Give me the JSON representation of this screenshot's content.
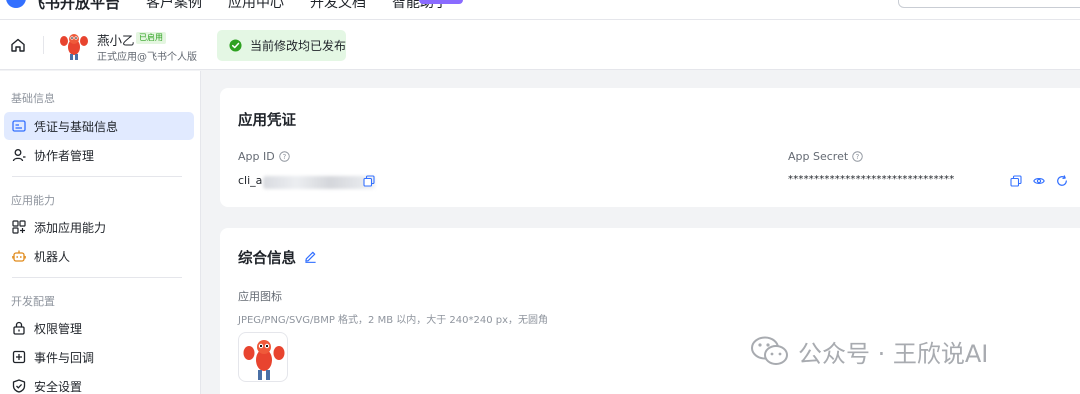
{
  "topnav": {
    "brand": "飞书开放平台",
    "menu": [
      "客户案例",
      "应用中心",
      "开发文档",
      "智能助手"
    ]
  },
  "header": {
    "app_name": "燕小乙",
    "app_status": "已启用",
    "app_subtitle": "正式应用@飞书个人版",
    "publish_status": "当前修改均已发布"
  },
  "sidebar": {
    "groups": [
      {
        "title": "基础信息",
        "items": [
          {
            "label": "凭证与基础信息",
            "icon": "credential-icon",
            "active": true
          },
          {
            "label": "协作者管理",
            "icon": "user-icon",
            "active": false
          }
        ]
      },
      {
        "title": "应用能力",
        "items": [
          {
            "label": "添加应用能力",
            "icon": "add-grid-icon",
            "active": false
          },
          {
            "label": "机器人",
            "icon": "robot-icon",
            "active": false
          }
        ]
      },
      {
        "title": "开发配置",
        "items": [
          {
            "label": "权限管理",
            "icon": "lock-icon",
            "active": false
          },
          {
            "label": "事件与回调",
            "icon": "event-icon",
            "active": false
          },
          {
            "label": "安全设置",
            "icon": "shield-icon",
            "active": false
          }
        ]
      }
    ]
  },
  "credentials": {
    "title": "应用凭证",
    "app_id_label": "App ID",
    "app_id_value": "cli_a",
    "app_secret_label": "App Secret",
    "app_secret_value": "********************************"
  },
  "general": {
    "title": "综合信息",
    "icon_label": "应用图标",
    "icon_hint": "JPEG/PNG/SVG/BMP 格式，2 MB 以内，大于 240*240 px，无圆角"
  },
  "watermark": {
    "text": "公众号 · 王欣说AI"
  },
  "colors": {
    "accent": "#3370ff",
    "active_bg": "#e1eaff",
    "success": "#2ea121",
    "success_bg": "#e4f7e4"
  }
}
